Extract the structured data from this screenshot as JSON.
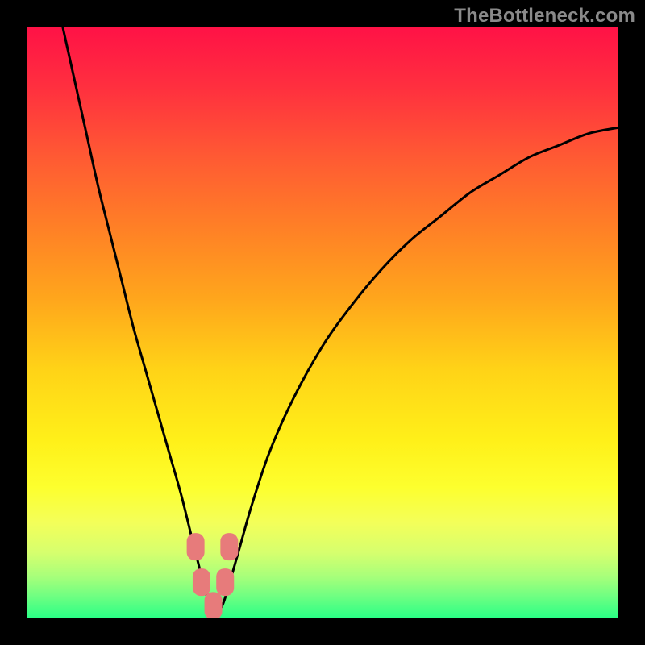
{
  "watermark": "TheBottleneck.com",
  "chart_data": {
    "type": "line",
    "title": "",
    "xlabel": "",
    "ylabel": "",
    "xlim": [
      0,
      100
    ],
    "ylim": [
      0,
      100
    ],
    "series": [
      {
        "name": "bottleneck-curve",
        "x": [
          6,
          8,
          10,
          12,
          14,
          16,
          18,
          20,
          22,
          24,
          26,
          27.5,
          29,
          30,
          31,
          32,
          33,
          34,
          36,
          38,
          41,
          45,
          50,
          55,
          60,
          65,
          70,
          75,
          80,
          85,
          90,
          95,
          100
        ],
        "values": [
          100,
          91,
          82,
          73,
          65,
          57,
          49,
          42,
          35,
          28,
          21,
          15,
          9,
          5,
          2,
          1,
          2,
          5,
          12,
          19,
          28,
          37,
          46,
          53,
          59,
          64,
          68,
          72,
          75,
          78,
          80,
          82,
          83
        ]
      }
    ],
    "markers": [
      {
        "name": "marker-left",
        "x": 28.5,
        "y": 12
      },
      {
        "name": "marker-mid-1",
        "x": 29.5,
        "y": 6
      },
      {
        "name": "marker-bottom",
        "x": 31.5,
        "y": 2
      },
      {
        "name": "marker-mid-2",
        "x": 33.5,
        "y": 6
      },
      {
        "name": "marker-right",
        "x": 34.2,
        "y": 12
      }
    ],
    "gradient_stops": [
      {
        "offset": 0.0,
        "color": "#ff1246"
      },
      {
        "offset": 0.1,
        "color": "#ff2f3f"
      },
      {
        "offset": 0.22,
        "color": "#ff5a33"
      },
      {
        "offset": 0.34,
        "color": "#ff8026"
      },
      {
        "offset": 0.46,
        "color": "#ffa61c"
      },
      {
        "offset": 0.58,
        "color": "#ffd317"
      },
      {
        "offset": 0.7,
        "color": "#fff019"
      },
      {
        "offset": 0.78,
        "color": "#fdff2e"
      },
      {
        "offset": 0.84,
        "color": "#f3ff5a"
      },
      {
        "offset": 0.89,
        "color": "#d6ff6e"
      },
      {
        "offset": 0.93,
        "color": "#a8ff7a"
      },
      {
        "offset": 0.965,
        "color": "#6dff82"
      },
      {
        "offset": 1.0,
        "color": "#2bff85"
      }
    ],
    "marker_style": {
      "fill": "#e77b7b",
      "rx": 10,
      "w": 22,
      "h": 34
    },
    "curve_style": {
      "stroke": "#000000",
      "width": 3.0
    }
  }
}
